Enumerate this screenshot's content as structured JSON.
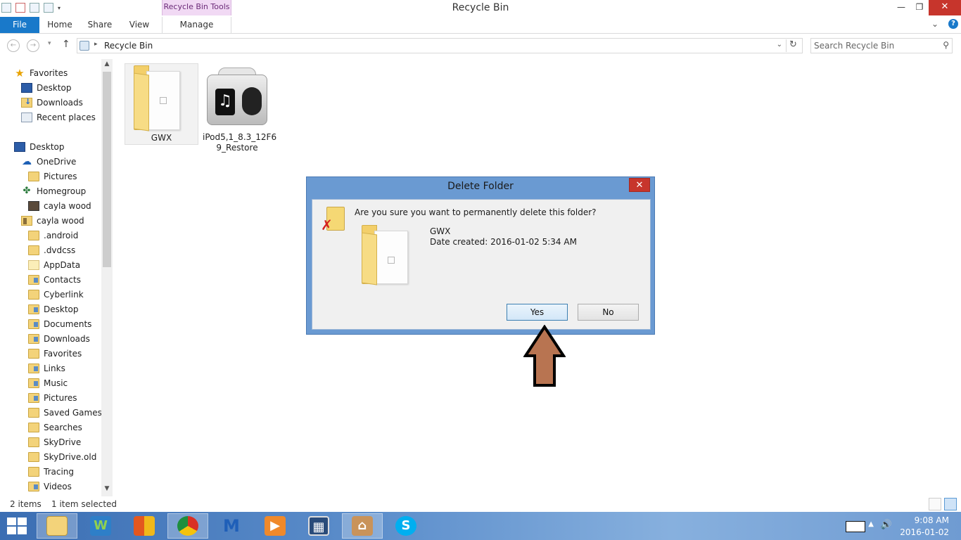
{
  "window": {
    "title": "Recycle Bin",
    "context_tab_group": "Recycle Bin Tools",
    "minimize": "—",
    "restore": "❐",
    "close": "✕"
  },
  "ribbon": {
    "tabs": [
      {
        "label": "File"
      },
      {
        "label": "Home"
      },
      {
        "label": "Share"
      },
      {
        "label": "View"
      },
      {
        "label": "Manage"
      }
    ],
    "expand": "⌄",
    "help": "?"
  },
  "address_bar": {
    "back": "←",
    "forward": "→",
    "recent": "▾",
    "up": "↑",
    "breadcrumb": "Recycle Bin",
    "separator": "▸",
    "dropdown": "⌄",
    "refresh": "↻",
    "search_placeholder": "Search Recycle Bin",
    "search_glyph": "⚲"
  },
  "nav_pane": {
    "items": [
      {
        "label": "Favorites",
        "icon": "star-icon"
      },
      {
        "label": "Desktop",
        "icon": "desktop-icon"
      },
      {
        "label": "Downloads",
        "icon": "downloads-icon"
      },
      {
        "label": "Recent places",
        "icon": "recent-places-icon"
      },
      {
        "label": "Desktop",
        "icon": "desktop-icon"
      },
      {
        "label": "OneDrive",
        "icon": "onedrive-icon"
      },
      {
        "label": "Pictures",
        "icon": "folder-icon"
      },
      {
        "label": "Homegroup",
        "icon": "homegroup-icon"
      },
      {
        "label": "cayla wood",
        "icon": "user-photo-icon"
      },
      {
        "label": "cayla wood",
        "icon": "user-folder-icon"
      },
      {
        "label": ".android",
        "icon": "folder-icon"
      },
      {
        "label": ".dvdcss",
        "icon": "folder-icon"
      },
      {
        "label": "AppData",
        "icon": "folder-icon"
      },
      {
        "label": "Contacts",
        "icon": "folder-icon"
      },
      {
        "label": "Cyberlink",
        "icon": "folder-icon"
      },
      {
        "label": "Desktop",
        "icon": "folder-icon"
      },
      {
        "label": "Documents",
        "icon": "folder-icon"
      },
      {
        "label": "Downloads",
        "icon": "folder-icon"
      },
      {
        "label": "Favorites",
        "icon": "folder-icon"
      },
      {
        "label": "Links",
        "icon": "folder-icon"
      },
      {
        "label": "Music",
        "icon": "folder-icon"
      },
      {
        "label": "Pictures",
        "icon": "folder-icon"
      },
      {
        "label": "Saved Games",
        "icon": "folder-icon"
      },
      {
        "label": "Searches",
        "icon": "folder-icon"
      },
      {
        "label": "SkyDrive",
        "icon": "folder-icon"
      },
      {
        "label": "SkyDrive.old",
        "icon": "folder-icon"
      },
      {
        "label": "Tracing",
        "icon": "folder-icon"
      },
      {
        "label": "Videos",
        "icon": "folder-icon"
      }
    ]
  },
  "files": [
    {
      "name": "GWX",
      "icon": "folder-icon",
      "selected": true
    },
    {
      "name": "iPod5,1_8.3_12F69_Restore",
      "name_line1": "iPod5,1_8.3_12F6",
      "name_line2": "9_Restore",
      "icon": "ipod-restore-icon",
      "selected": false
    }
  ],
  "status_bar": {
    "item_count": "2 items",
    "selection": "1 item selected"
  },
  "dialog": {
    "title": "Delete Folder",
    "close": "✕",
    "question": "Are you sure you want to permanently delete this folder?",
    "item_name": "GWX",
    "item_date": "Date created: 2016-01-02 5:34 AM",
    "yes_label": "Yes",
    "no_label": "No"
  },
  "taskbar": {
    "apps": [
      {
        "name": "file-explorer-icon",
        "active": true
      },
      {
        "name": "wps-writer-icon",
        "glyph": "W",
        "color": "#2e7fc8"
      },
      {
        "name": "office-icon",
        "color": "#e3571f"
      },
      {
        "name": "chrome-icon",
        "active": true
      },
      {
        "name": "malwarebytes-icon",
        "color": "#1f5fb8"
      },
      {
        "name": "video-player-icon",
        "color": "#f0892a"
      },
      {
        "name": "movie-maker-icon",
        "color": "#2a4c7a"
      },
      {
        "name": "museum-app-icon",
        "active": true
      },
      {
        "name": "skype-icon",
        "glyph": "S",
        "color": "#00aff0"
      }
    ],
    "time": "9:08 AM",
    "date": "2016-01-02",
    "tray_up": "▲",
    "volume": "🔊"
  },
  "colors": {
    "accent": "#1979ca",
    "dialog_frame": "#6a9ad2",
    "close_red": "#c7352c",
    "annotation_arrow": "#b87451"
  }
}
